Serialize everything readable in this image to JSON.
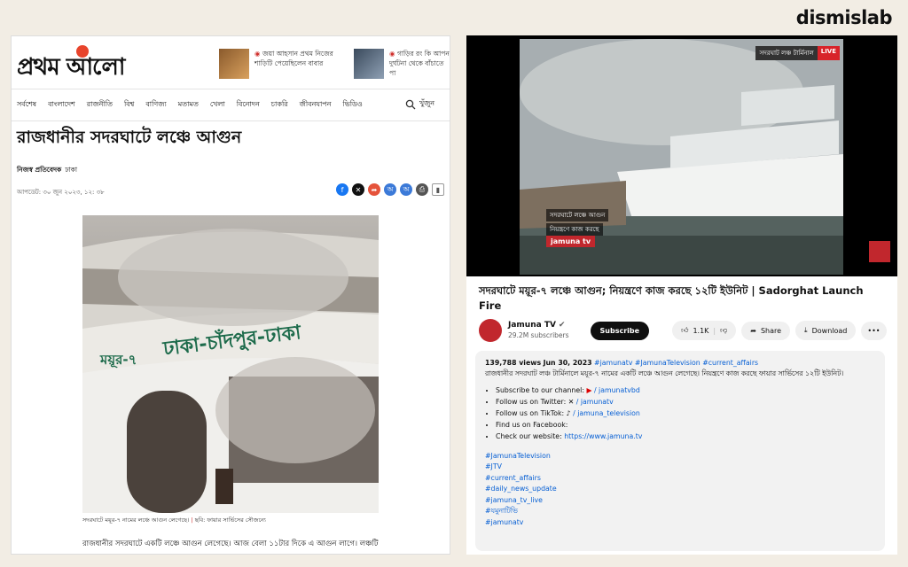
{
  "brand": "dismislab",
  "left": {
    "logo": "প্রথম আলো",
    "teasers": [
      {
        "text": "জয়া আহসান প্রথম নিজের শাড়িটি পেয়েছিলেন বাবার"
      },
      {
        "text": "গাড়ির রং কি আপন দুর্ঘটনা থেকে বাঁচাতে পা"
      }
    ],
    "nav": [
      "সর্বশেষ",
      "বাংলাদেশ",
      "রাজনীতি",
      "বিশ্ব",
      "বাণিজ্য",
      "মতামত",
      "খেলা",
      "বিনোদন",
      "চাকরি",
      "জীবনযাপন",
      "ভিডিও"
    ],
    "search_label": "খুঁজুন",
    "headline": "রাজধানীর সদরঘাটে লঞ্চে আগুন",
    "author": "নিজস্ব প্রতিবেদক",
    "author_loc": "ঢাকা",
    "date": "আপডেট: ৩০ জুন ২০২৩, ১২: ৩৮",
    "photo_text": {
      "name": "ময়ূর-৭",
      "route": "ঢাকা-চাঁদপুর-ঢাকা"
    },
    "caption": "সদরঘাটে ময়ূর-৭ নামের লঞ্চে আগুন লেগেছে।",
    "caption_credit": "ছবি: ফায়ার সার্ভিসের সৌজন্যে",
    "body": "রাজধানীর সদরঘাটে একটি লঞ্চে আগুন লেগেছে। আজ বেলা ১১টার দিকে এ আগুন লাগে। লঞ্চটি"
  },
  "right": {
    "live_location": "সদরঘাট লঞ্চ টার্মিনাল",
    "live": "LIVE",
    "lower_third": [
      "সদরঘাটে লঞ্চে আগুন",
      "নিয়ন্ত্রণে কাজ করছে"
    ],
    "channel_logo": "jamuna tv",
    "title": "সদরঘাটে ময়ূর-৭ লঞ্চে আগুন; নিয়ন্ত্রণে কাজ করছে ১২টি ইউনিট | Sadorghat Launch Fire",
    "channel": "Jamuna TV",
    "subscribers": "29.2M subscribers",
    "subscribe": "Subscribe",
    "likes": "1.1K",
    "share": "Share",
    "download": "Download",
    "views": "139,788 views",
    "date": "Jun 30, 2023",
    "hashtags_top": "#jamunatv #JamunaTelevision #current_affairs",
    "desc_text": "রাজধানীর সদরঘাট লঞ্চ টার্মিনালে ময়ূর-৭ নামের একটি লঞ্চে আগুন লেগেছে। নিয়ন্ত্রণে কাজ করছে ফায়ার সার্ভিসের ১২টি ইউনিট।",
    "links": [
      {
        "label": "Subscribe to our channel:",
        "value": "/ jamunatvbd"
      },
      {
        "label": "Follow us on Twitter:",
        "value": "/ jamunatv"
      },
      {
        "label": "Follow us on TikTok:",
        "value": "/ jamuna_television"
      },
      {
        "label": "Find us on Facebook:",
        "value": ""
      },
      {
        "label": "Check our website:",
        "value": "https://www.jamuna.tv"
      }
    ],
    "tags": [
      "#JamunaTelevision",
      "#JTV",
      "#current_affairs",
      "#daily_news_update",
      "#jamuna_tv_live",
      "#যমুনাটিভি",
      "#jamunatv"
    ]
  }
}
